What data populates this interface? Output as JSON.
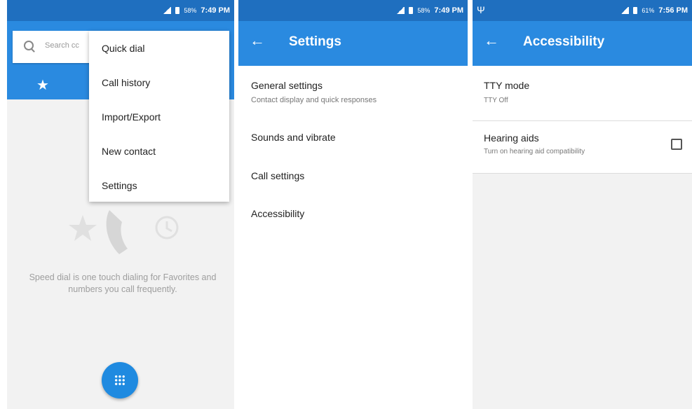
{
  "colors": {
    "status_bar": "#1f6fbf",
    "app_bar": "#2a8ae0",
    "fab": "#1f8ae0"
  },
  "panel1": {
    "status": {
      "battery": "58%",
      "time": "7:49 PM"
    },
    "search": {
      "placeholder": "Search cc"
    },
    "overflow_menu": {
      "items": [
        {
          "label": "Quick dial"
        },
        {
          "label": "Call history"
        },
        {
          "label": "Import/Export"
        },
        {
          "label": "New contact"
        },
        {
          "label": "Settings"
        }
      ]
    },
    "tab_icon": "star-icon",
    "empty_message": "Speed dial is one touch dialing for Favorites and numbers you call frequently.",
    "fab_icon": "dialpad-icon"
  },
  "panel2": {
    "status": {
      "battery": "58%",
      "time": "7:49 PM"
    },
    "app_bar": {
      "title": "Settings",
      "back_icon": "arrow-back-icon"
    },
    "items": [
      {
        "label": "General settings",
        "subtitle": "Contact display and quick responses"
      },
      {
        "label": "Sounds and vibrate"
      },
      {
        "label": "Call settings"
      },
      {
        "label": "Accessibility"
      }
    ]
  },
  "panel3": {
    "status": {
      "battery": "61%",
      "time": "7:56 PM",
      "usb_icon": "usb-icon"
    },
    "app_bar": {
      "title": "Accessibility",
      "back_icon": "arrow-back-icon"
    },
    "items": [
      {
        "label": "TTY mode",
        "subtitle": "TTY Off"
      },
      {
        "label": "Hearing aids",
        "subtitle": "Turn on hearing aid compatibility",
        "checked": false
      }
    ]
  }
}
